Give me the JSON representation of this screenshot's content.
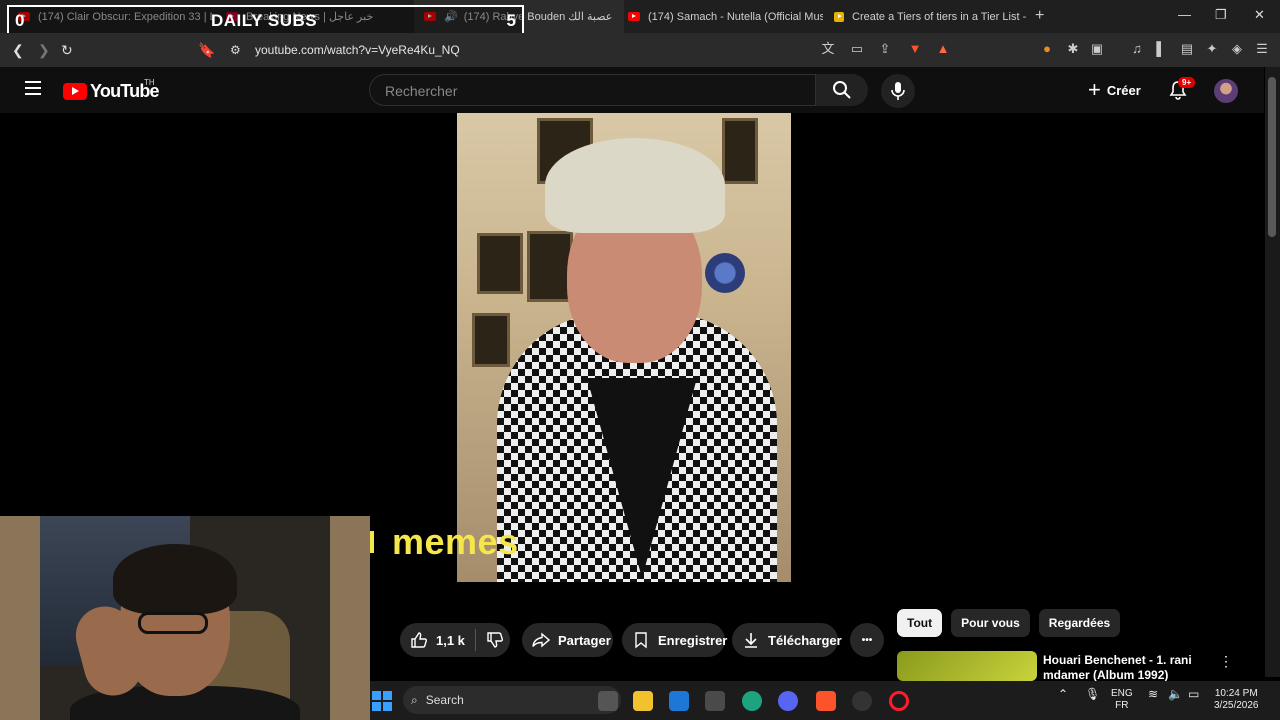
{
  "browser": {
    "tabs": [
      {
        "title": "(174) Clair Obscur: Expedition 33 | Lu",
        "active": false
      },
      {
        "title": "Breaking News | خبر عاجل",
        "active": false
      },
      {
        "title": "(174) Rabye Bouden عصبة الك",
        "active": true
      },
      {
        "title": "(174) Samach - Nutella (Official Musi",
        "active": false
      },
      {
        "title": "Create a Tiers of tiers in a Tier List - T",
        "active": false
      }
    ],
    "new_tab": "+",
    "url": "youtube.com/watch?v=VyeRe4Ku_NQ"
  },
  "overlay": {
    "left_count": "0",
    "title": "DAILY SUBS",
    "right_count": "5"
  },
  "youtube": {
    "logo_text": "YouTube",
    "country_code": "TH",
    "search_placeholder": "Rechercher",
    "create_label": "Créer",
    "notification_badge": "9+"
  },
  "video": {
    "caption": "memes"
  },
  "actions": {
    "like_count": "1,1 k",
    "share_label": "Partager",
    "save_label": "Enregistrer",
    "download_label": "Télécharger",
    "more_label": "•••"
  },
  "chips": [
    "Tout",
    "Pour vous",
    "Regardées"
  ],
  "recommendation": {
    "title": "Houari Benchenet - 1.  rani mdamer (Album 1992)"
  },
  "taskbar": {
    "search_label": "Search",
    "lang_top": "ENG",
    "lang_bottom": "FR",
    "time": "10:24 PM",
    "date": "3/25/2026"
  },
  "colors": {
    "accent": "#ff0000",
    "caption": "#f4e64b"
  }
}
